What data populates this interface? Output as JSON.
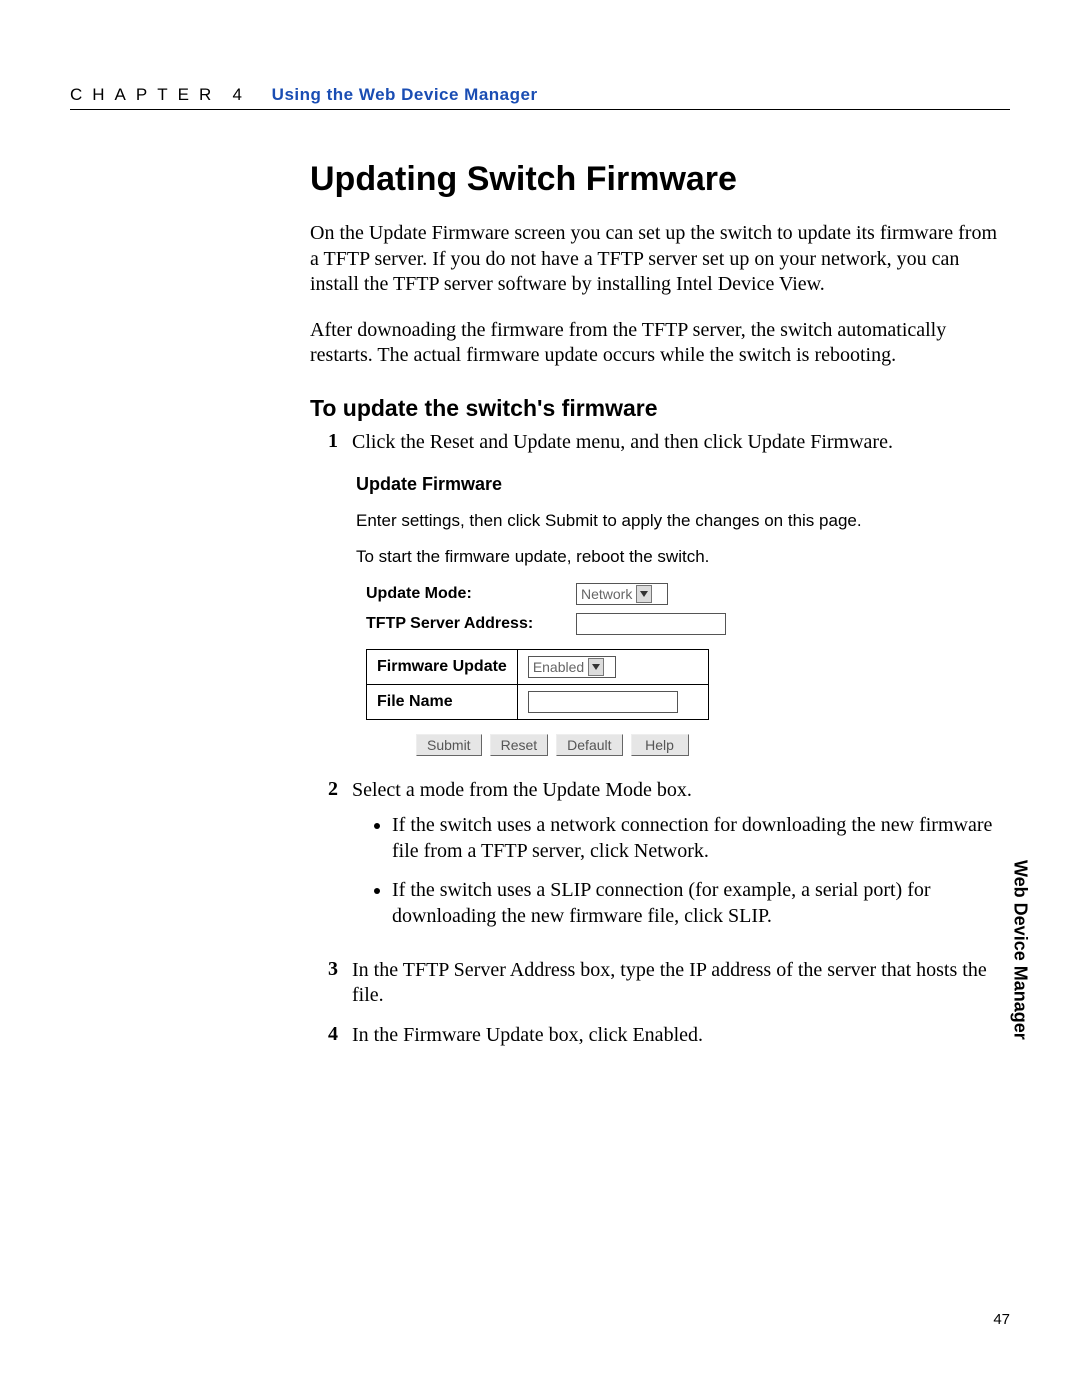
{
  "header": {
    "chapter_word": "CHAPTER",
    "chapter_num": "4",
    "section": "Using the Web Device Manager"
  },
  "title": "Updating Switch Firmware",
  "paragraphs": {
    "p1": "On the Update Firmware screen you can set up the switch to update its firmware from a TFTP server. If you do not have a TFTP server set up on your network, you can install the TFTP server software by installing Intel Device View.",
    "p2": "After downoading the firmware from the TFTP server, the switch automatically restarts. The actual firmware update occurs while the switch is rebooting."
  },
  "subhead": "To update the switch's firmware",
  "steps": {
    "s1": "Click the Reset and Update menu, and then click Update Firmware.",
    "s2": "Select a mode from the Update Mode box.",
    "s2_bullets": {
      "b1": "If the switch uses a network connection for downloading the new firmware file from a TFTP server, click Network.",
      "b2": "If the switch uses a SLIP connection (for example, a serial port) for downloading the new firmware file, click SLIP."
    },
    "s3": "In the TFTP Server Address box, type the IP address of the server that hosts the file.",
    "s4": "In the Firmware Update box, click Enabled."
  },
  "ui": {
    "title": "Update Firmware",
    "line1": "Enter settings, then click Submit to apply the changes on this page.",
    "line2": "To start the firmware update, reboot the switch.",
    "update_mode_label": "Update Mode:",
    "update_mode_value": "Network",
    "tftp_label": "TFTP Server Address:",
    "tftp_value": "",
    "fw_update_label": "Firmware Update",
    "fw_update_value": "Enabled",
    "file_name_label": "File Name",
    "file_name_value": "",
    "buttons": {
      "submit": "Submit",
      "reset": "Reset",
      "default": "Default",
      "help": "Help"
    }
  },
  "side_tab": "Web Device Manager",
  "page_number": "47"
}
